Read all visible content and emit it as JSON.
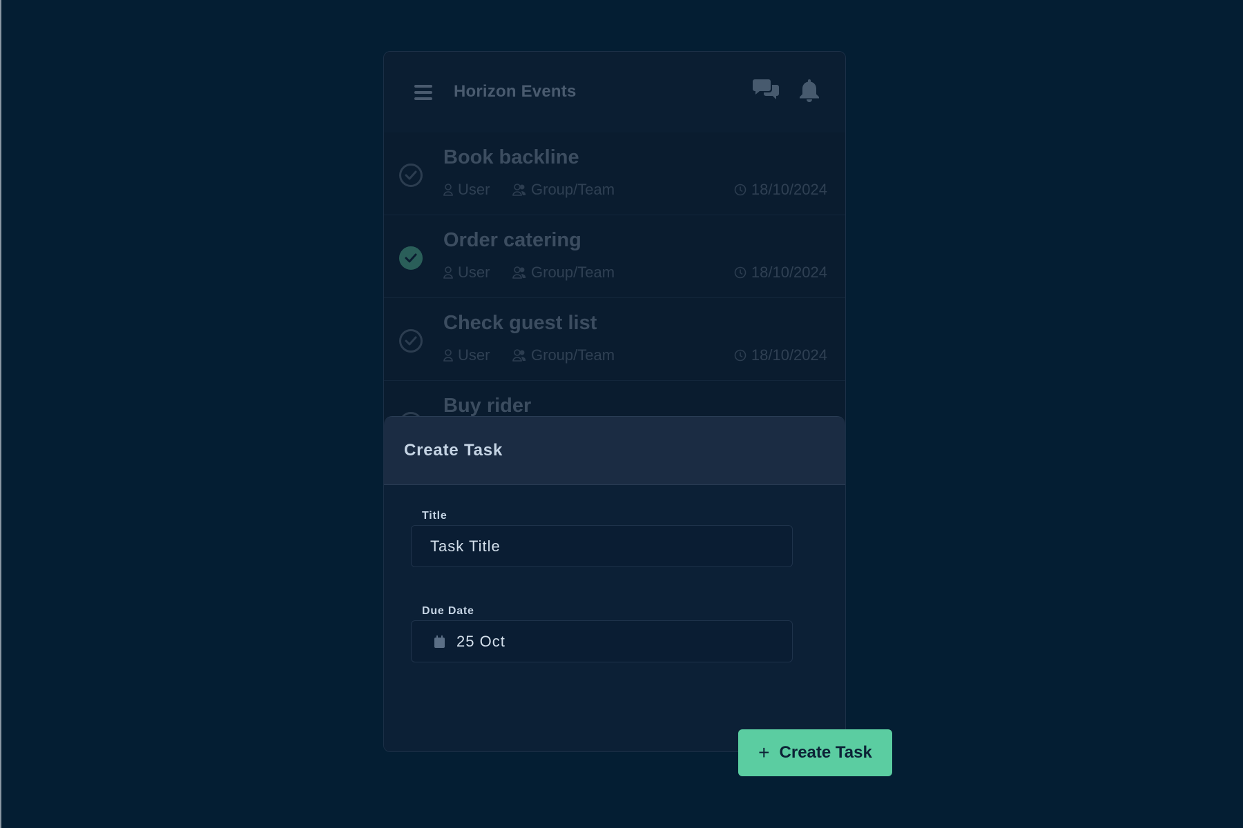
{
  "header": {
    "title": "Horizon Events",
    "icons": {
      "menu": "menu-icon",
      "chat": "chat-icon",
      "notifications": "bell-icon"
    }
  },
  "tasks": [
    {
      "title": "Book backline",
      "user": "User",
      "group": "Group/Team",
      "date": "18/10/2024",
      "done": false
    },
    {
      "title": "Order catering",
      "user": "User",
      "group": "Group/Team",
      "date": "18/10/2024",
      "done": true
    },
    {
      "title": "Check guest list",
      "user": "User",
      "group": "Group/Team",
      "date": "18/10/2024",
      "done": false
    },
    {
      "title": "Buy rider",
      "done": false
    }
  ],
  "sheet": {
    "title": "Create Task",
    "fields": {
      "title_label": "Title",
      "title_value": "Task Title",
      "due_label": "Due Date",
      "due_value": "25 Oct"
    }
  },
  "create_button": {
    "label": "Create Task",
    "icon": "plus-icon"
  },
  "colors": {
    "background": "#041e33",
    "accent": "#5bcda1",
    "done_check": "#2a5e59"
  }
}
